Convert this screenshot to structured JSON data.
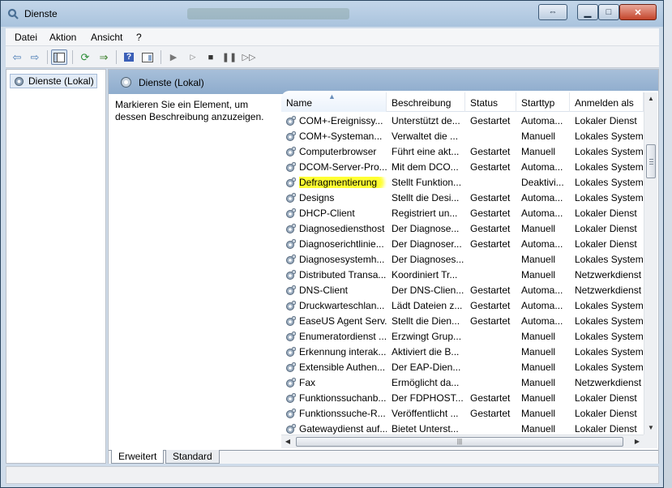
{
  "window": {
    "title": "Dienste"
  },
  "menu": [
    "Datei",
    "Aktion",
    "Ansicht",
    "?"
  ],
  "tree": {
    "item": "Dienste (Lokal)"
  },
  "panel": {
    "header": "Dienste (Lokal)",
    "description": "Markieren Sie ein Element, um dessen Beschreibung anzuzeigen."
  },
  "columns": [
    "Name",
    "Beschreibung",
    "Status",
    "Starttyp",
    "Anmelden als"
  ],
  "services": [
    [
      "COM+-Ereignissy...",
      "Unterstützt de...",
      "Gestartet",
      "Automa...",
      "Lokaler Dienst"
    ],
    [
      "COM+-Systeman...",
      "Verwaltet die ...",
      "",
      "Manuell",
      "Lokales System"
    ],
    [
      "Computerbrowser",
      "Führt eine akt...",
      "Gestartet",
      "Manuell",
      "Lokales System"
    ],
    [
      "DCOM-Server-Pro...",
      "Mit dem DCO...",
      "Gestartet",
      "Automa...",
      "Lokales System"
    ],
    [
      "Defragmentierung",
      "Stellt Funktion...",
      "",
      "Deaktivi...",
      "Lokales System"
    ],
    [
      "Designs",
      "Stellt die Desi...",
      "Gestartet",
      "Automa...",
      "Lokales System"
    ],
    [
      "DHCP-Client",
      "Registriert un...",
      "Gestartet",
      "Automa...",
      "Lokaler Dienst"
    ],
    [
      "Diagnosediensthost",
      "Der Diagnose...",
      "Gestartet",
      "Manuell",
      "Lokaler Dienst"
    ],
    [
      "Diagnoserichtlinie...",
      "Der Diagnoser...",
      "Gestartet",
      "Automa...",
      "Lokaler Dienst"
    ],
    [
      "Diagnosesystemh...",
      "Der Diagnoses...",
      "",
      "Manuell",
      "Lokales System"
    ],
    [
      "Distributed Transa...",
      "Koordiniert Tr...",
      "",
      "Manuell",
      "Netzwerkdienst"
    ],
    [
      "DNS-Client",
      "Der DNS-Clien...",
      "Gestartet",
      "Automa...",
      "Netzwerkdienst"
    ],
    [
      "Druckwarteschlan...",
      "Lädt Dateien z...",
      "Gestartet",
      "Automa...",
      "Lokales System"
    ],
    [
      "EaseUS Agent Serv...",
      "Stellt die Dien...",
      "Gestartet",
      "Automa...",
      "Lokales System"
    ],
    [
      "Enumeratordienst ...",
      "Erzwingt Grup...",
      "",
      "Manuell",
      "Lokales System"
    ],
    [
      "Erkennung interak...",
      "Aktiviert die B...",
      "",
      "Manuell",
      "Lokales System"
    ],
    [
      "Extensible Authen...",
      "Der EAP-Dien...",
      "",
      "Manuell",
      "Lokales System"
    ],
    [
      "Fax",
      "Ermöglicht da...",
      "",
      "Manuell",
      "Netzwerkdienst"
    ],
    [
      "Funktionssuchanb...",
      "Der FDPHOST...",
      "Gestartet",
      "Manuell",
      "Lokaler Dienst"
    ],
    [
      "Funktionssuche-R...",
      "Veröffentlicht ...",
      "Gestartet",
      "Manuell",
      "Lokaler Dienst"
    ],
    [
      "Gatewaydienst auf...",
      "Bietet Unterst...",
      "",
      "Manuell",
      "Lokaler Dienst"
    ]
  ],
  "highlighted_row": 4,
  "highlight_color": "#ffff33",
  "tabs": [
    "Erweitert",
    "Standard"
  ],
  "active_tab": 0
}
